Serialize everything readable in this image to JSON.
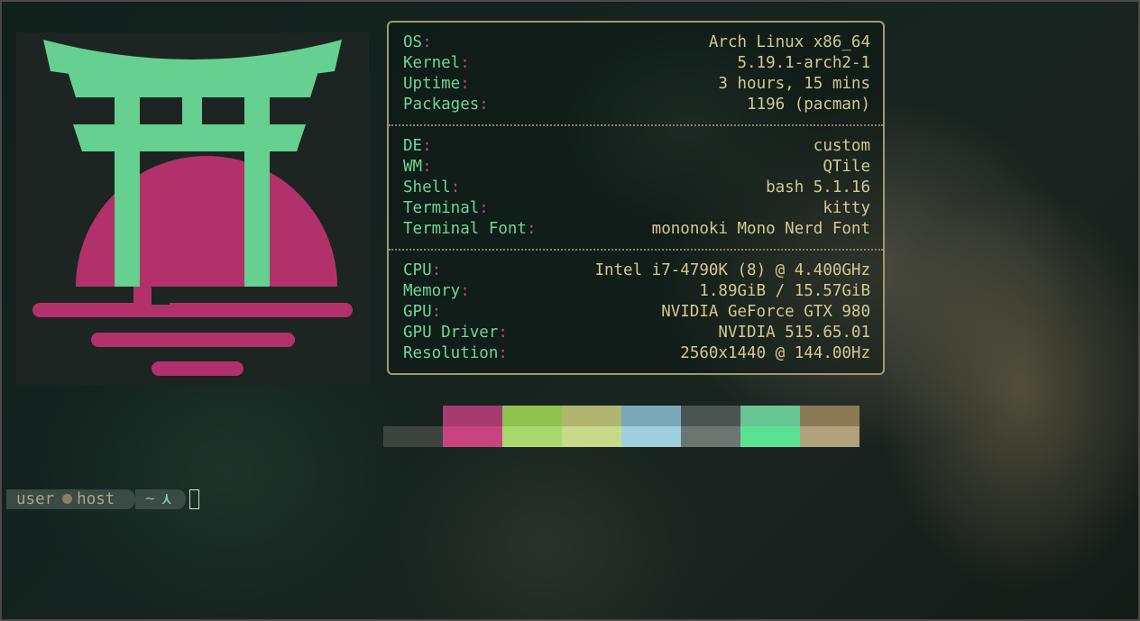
{
  "info": {
    "sections": [
      {
        "rows": [
          {
            "key": "OS",
            "value": "Arch Linux x86_64"
          },
          {
            "key": "Kernel",
            "value": "5.19.1-arch2-1"
          },
          {
            "key": "Uptime",
            "value": "3 hours, 15 mins"
          },
          {
            "key": "Packages",
            "value": "1196 (pacman)"
          }
        ]
      },
      {
        "rows": [
          {
            "key": "DE",
            "value": "custom"
          },
          {
            "key": "WM",
            "value": "QTile"
          },
          {
            "key": "Shell",
            "value": "bash 5.1.16"
          },
          {
            "key": "Terminal",
            "value": "kitty"
          },
          {
            "key": "Terminal Font",
            "value": "mononoki Mono Nerd Font"
          }
        ]
      },
      {
        "rows": [
          {
            "key": "CPU",
            "value": "Intel i7-4790K (8) @ 4.400GHz"
          },
          {
            "key": "Memory",
            "value": "1.89GiB / 15.57GiB"
          },
          {
            "key": "GPU",
            "value": "NVIDIA GeForce GTX 980"
          },
          {
            "key": "GPU Driver",
            "value": "NVIDIA 515.65.01"
          },
          {
            "key": "Resolution",
            "value": "2560x1440 @ 144.00Hz"
          }
        ]
      }
    ]
  },
  "colon": ":",
  "palette": {
    "normal": [
      "#111a17",
      "#a73a6f",
      "#90c252",
      "#b0b570",
      "#7ba9b9",
      "#4a5551",
      "#68c593",
      "#8a7b56"
    ],
    "bright": [
      "#3d4440",
      "#c8447e",
      "#a9d86d",
      "#c8d98a",
      "#9fcfdd",
      "#6b7670",
      "#59e390",
      "#afa17c"
    ]
  },
  "logo": {
    "icon": "torii-gate-icon",
    "gate_color": "#65d08f",
    "sun_color": "#b3316a",
    "background": "#1c2522"
  },
  "prompt": {
    "user": "user",
    "host": "host",
    "dir": "~",
    "arrow": "⋏"
  }
}
